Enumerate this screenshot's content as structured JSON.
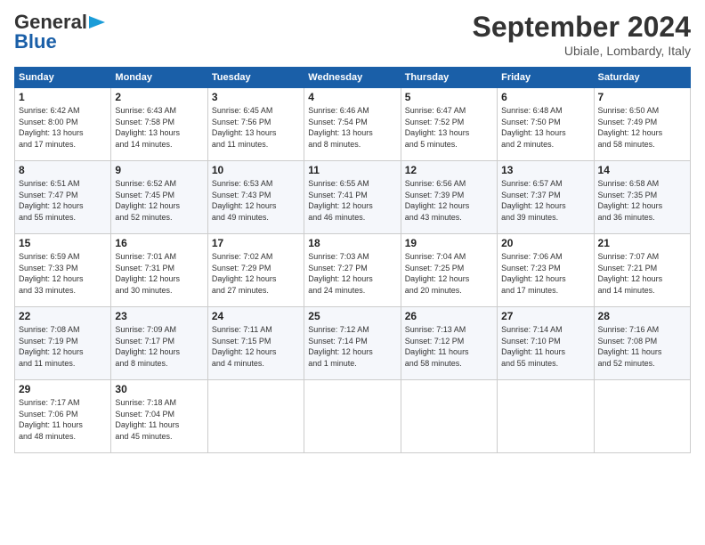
{
  "logo": {
    "line1": "General",
    "line2": "Blue"
  },
  "header": {
    "month": "September 2024",
    "location": "Ubiale, Lombardy, Italy"
  },
  "weekdays": [
    "Sunday",
    "Monday",
    "Tuesday",
    "Wednesday",
    "Thursday",
    "Friday",
    "Saturday"
  ],
  "weeks": [
    [
      {
        "day": "1",
        "info": "Sunrise: 6:42 AM\nSunset: 8:00 PM\nDaylight: 13 hours\nand 17 minutes."
      },
      {
        "day": "2",
        "info": "Sunrise: 6:43 AM\nSunset: 7:58 PM\nDaylight: 13 hours\nand 14 minutes."
      },
      {
        "day": "3",
        "info": "Sunrise: 6:45 AM\nSunset: 7:56 PM\nDaylight: 13 hours\nand 11 minutes."
      },
      {
        "day": "4",
        "info": "Sunrise: 6:46 AM\nSunset: 7:54 PM\nDaylight: 13 hours\nand 8 minutes."
      },
      {
        "day": "5",
        "info": "Sunrise: 6:47 AM\nSunset: 7:52 PM\nDaylight: 13 hours\nand 5 minutes."
      },
      {
        "day": "6",
        "info": "Sunrise: 6:48 AM\nSunset: 7:50 PM\nDaylight: 13 hours\nand 2 minutes."
      },
      {
        "day": "7",
        "info": "Sunrise: 6:50 AM\nSunset: 7:49 PM\nDaylight: 12 hours\nand 58 minutes."
      }
    ],
    [
      {
        "day": "8",
        "info": "Sunrise: 6:51 AM\nSunset: 7:47 PM\nDaylight: 12 hours\nand 55 minutes."
      },
      {
        "day": "9",
        "info": "Sunrise: 6:52 AM\nSunset: 7:45 PM\nDaylight: 12 hours\nand 52 minutes."
      },
      {
        "day": "10",
        "info": "Sunrise: 6:53 AM\nSunset: 7:43 PM\nDaylight: 12 hours\nand 49 minutes."
      },
      {
        "day": "11",
        "info": "Sunrise: 6:55 AM\nSunset: 7:41 PM\nDaylight: 12 hours\nand 46 minutes."
      },
      {
        "day": "12",
        "info": "Sunrise: 6:56 AM\nSunset: 7:39 PM\nDaylight: 12 hours\nand 43 minutes."
      },
      {
        "day": "13",
        "info": "Sunrise: 6:57 AM\nSunset: 7:37 PM\nDaylight: 12 hours\nand 39 minutes."
      },
      {
        "day": "14",
        "info": "Sunrise: 6:58 AM\nSunset: 7:35 PM\nDaylight: 12 hours\nand 36 minutes."
      }
    ],
    [
      {
        "day": "15",
        "info": "Sunrise: 6:59 AM\nSunset: 7:33 PM\nDaylight: 12 hours\nand 33 minutes."
      },
      {
        "day": "16",
        "info": "Sunrise: 7:01 AM\nSunset: 7:31 PM\nDaylight: 12 hours\nand 30 minutes."
      },
      {
        "day": "17",
        "info": "Sunrise: 7:02 AM\nSunset: 7:29 PM\nDaylight: 12 hours\nand 27 minutes."
      },
      {
        "day": "18",
        "info": "Sunrise: 7:03 AM\nSunset: 7:27 PM\nDaylight: 12 hours\nand 24 minutes."
      },
      {
        "day": "19",
        "info": "Sunrise: 7:04 AM\nSunset: 7:25 PM\nDaylight: 12 hours\nand 20 minutes."
      },
      {
        "day": "20",
        "info": "Sunrise: 7:06 AM\nSunset: 7:23 PM\nDaylight: 12 hours\nand 17 minutes."
      },
      {
        "day": "21",
        "info": "Sunrise: 7:07 AM\nSunset: 7:21 PM\nDaylight: 12 hours\nand 14 minutes."
      }
    ],
    [
      {
        "day": "22",
        "info": "Sunrise: 7:08 AM\nSunset: 7:19 PM\nDaylight: 12 hours\nand 11 minutes."
      },
      {
        "day": "23",
        "info": "Sunrise: 7:09 AM\nSunset: 7:17 PM\nDaylight: 12 hours\nand 8 minutes."
      },
      {
        "day": "24",
        "info": "Sunrise: 7:11 AM\nSunset: 7:15 PM\nDaylight: 12 hours\nand 4 minutes."
      },
      {
        "day": "25",
        "info": "Sunrise: 7:12 AM\nSunset: 7:14 PM\nDaylight: 12 hours\nand 1 minute."
      },
      {
        "day": "26",
        "info": "Sunrise: 7:13 AM\nSunset: 7:12 PM\nDaylight: 11 hours\nand 58 minutes."
      },
      {
        "day": "27",
        "info": "Sunrise: 7:14 AM\nSunset: 7:10 PM\nDaylight: 11 hours\nand 55 minutes."
      },
      {
        "day": "28",
        "info": "Sunrise: 7:16 AM\nSunset: 7:08 PM\nDaylight: 11 hours\nand 52 minutes."
      }
    ],
    [
      {
        "day": "29",
        "info": "Sunrise: 7:17 AM\nSunset: 7:06 PM\nDaylight: 11 hours\nand 48 minutes."
      },
      {
        "day": "30",
        "info": "Sunrise: 7:18 AM\nSunset: 7:04 PM\nDaylight: 11 hours\nand 45 minutes."
      },
      null,
      null,
      null,
      null,
      null
    ]
  ]
}
